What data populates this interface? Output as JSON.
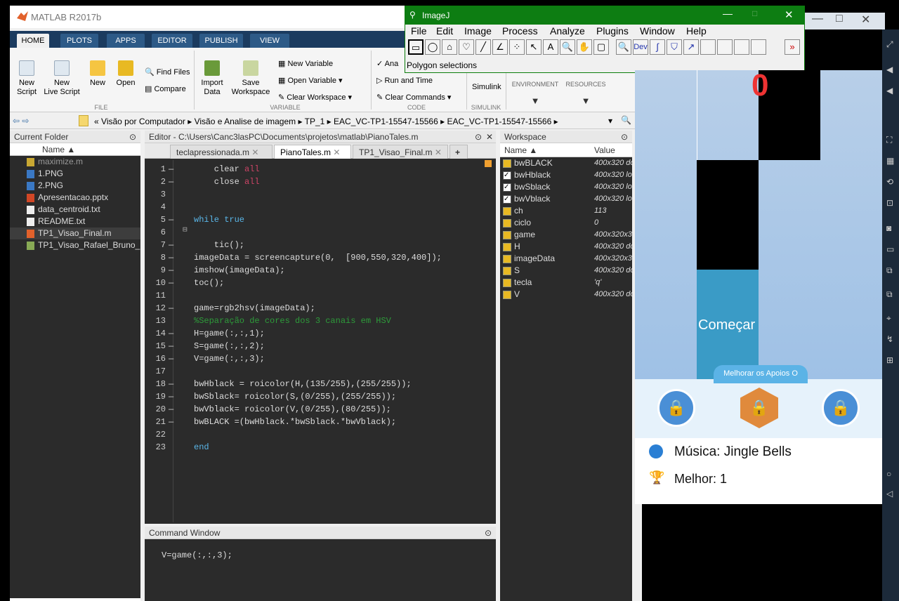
{
  "matlab": {
    "title": "MATLAB R2017b",
    "tabs": [
      "HOME",
      "PLOTS",
      "APPS",
      "EDITOR",
      "PUBLISH",
      "VIEW"
    ],
    "ribbon": {
      "new_script": "New\nScript",
      "new_live_script": "New\nLive Script",
      "new": "New",
      "open": "Open",
      "find_files": "Find Files",
      "compare": "Compare",
      "import_data": "Import\nData",
      "save_workspace": "Save\nWorkspace",
      "new_variable": "New Variable",
      "open_variable": "Open Variable",
      "clear_workspace": "Clear Workspace",
      "analyze": "Ana",
      "run_and_time": "Run and Time",
      "clear_commands": "Clear Commands",
      "simulink": "Simulink",
      "environment": "ENVIRONMENT",
      "resources": "RESOURCES",
      "group_file": "FILE",
      "group_variable": "VARIABLE",
      "group_code": "CODE",
      "group_simulink": "SIMULINK"
    },
    "address": [
      "«",
      "Visão por Computador",
      "Visão e Analise de imagem",
      "TP_1",
      "EAC_VC-TP1-15547-15566",
      "EAC_VC-TP1-15547-15566"
    ],
    "current_folder": {
      "title": "Current Folder",
      "name_header": "Name ▲",
      "files": [
        {
          "name": "maximize.m",
          "type": "folder"
        },
        {
          "name": "1.PNG",
          "type": "png"
        },
        {
          "name": "2.PNG",
          "type": "png"
        },
        {
          "name": "Apresentacao.pptx",
          "type": "pptx"
        },
        {
          "name": "data_centroid.txt",
          "type": "txt"
        },
        {
          "name": "README.txt",
          "type": "txt"
        },
        {
          "name": "TP1_Visao_Final.m",
          "type": "m"
        },
        {
          "name": "TP1_Visao_Rafael_Bruno_...",
          "type": "mlx"
        }
      ]
    },
    "editor": {
      "title": "Editor - C:\\Users\\Canc3lasPC\\Documents\\projetos\\matlab\\PianoTales.m",
      "tabs": [
        "teclapressionada.m",
        "PianoTales.m",
        "TP1_Visao_Final.m"
      ],
      "plus": "+",
      "lines": [
        "    clear all",
        "    close all",
        "",
        "",
        "while true",
        "",
        "    tic();",
        "imageData = screencapture(0,  [900,550,320,400]);",
        "imshow(imageData);",
        "toc();",
        "",
        "game=rgb2hsv(imageData);",
        "%Separação de cores dos 3 canais em HSV",
        "H=game(:,:,1);",
        "S=game(:,:,2);",
        "V=game(:,:,3);",
        "",
        "bwHblack = roicolor(H,(135/255),(255/255));",
        "bwSblack= roicolor(S,(0/255),(255/255));",
        "bwVblack= roicolor(V,(0/255),(80/255));",
        "bwBLACK =(bwHblack.*bwSblack.*bwVblack);",
        "",
        "end"
      ]
    },
    "command_window": {
      "title": "Command Window",
      "line": "V=game(:,:,3);"
    },
    "workspace": {
      "title": "Workspace",
      "headers": [
        "Name ▲",
        "Value"
      ],
      "vars": [
        {
          "name": "bwBLACK",
          "value": "400x320 do",
          "kind": "grid"
        },
        {
          "name": "bwHblack",
          "value": "400x320 lo",
          "kind": "check"
        },
        {
          "name": "bwSblack",
          "value": "400x320 lo",
          "kind": "check"
        },
        {
          "name": "bwVblack",
          "value": "400x320 lo",
          "kind": "check"
        },
        {
          "name": "ch",
          "value": "113",
          "kind": "grid"
        },
        {
          "name": "ciclo",
          "value": "0",
          "kind": "grid"
        },
        {
          "name": "game",
          "value": "400x320x3",
          "kind": "grid"
        },
        {
          "name": "H",
          "value": "400x320 do",
          "kind": "grid"
        },
        {
          "name": "imageData",
          "value": "400x320x3",
          "kind": "grid"
        },
        {
          "name": "S",
          "value": "400x320 do",
          "kind": "grid"
        },
        {
          "name": "tecla",
          "value": "'q'",
          "kind": "char"
        },
        {
          "name": "V",
          "value": "400x320 do",
          "kind": "grid"
        }
      ]
    }
  },
  "imagej": {
    "title": "ImageJ",
    "menu": [
      "File",
      "Edit",
      "Image",
      "Process",
      "Analyze",
      "Plugins",
      "Window",
      "Help"
    ],
    "status": "Polygon selections",
    "dev": "Dev",
    "more": "»"
  },
  "game": {
    "score": "0",
    "start": "Começar",
    "upgrade": "Melhorar os Apoios O",
    "music": "Música: Jingle Bells",
    "best": "Melhor: 1"
  },
  "colors": {
    "imagej_title": "#0d7d12",
    "matlab_tab_bar": "#1b3b5f",
    "code_bg": "#2b2b2b",
    "keyword": "#5ab6e8",
    "comment": "#2d9b3a"
  }
}
